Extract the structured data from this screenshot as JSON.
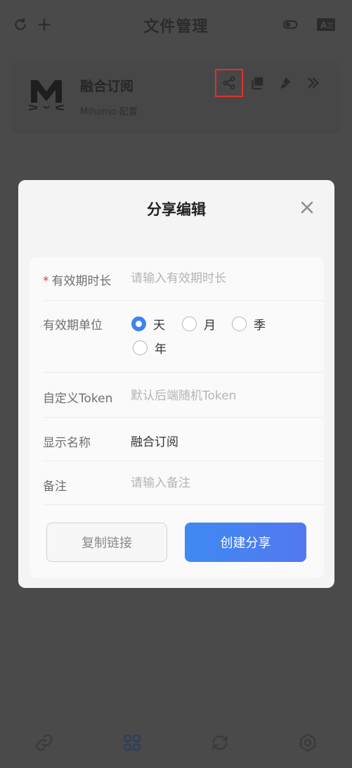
{
  "header": {
    "title": "文件管理",
    "left_icons": [
      "refresh-icon",
      "plus-icon"
    ],
    "right_icons": [
      "toggle-icon",
      "translate-icon"
    ]
  },
  "profile": {
    "name": "融合订阅",
    "subtitle": "Mihomo 配置",
    "actions": [
      "share-icon",
      "copy-icon",
      "edit-pen-icon",
      "more-chevron-icon"
    ]
  },
  "modal": {
    "title": "分享编辑",
    "fields": {
      "duration": {
        "label": "有效期时长",
        "required_mark": "*",
        "value": "",
        "placeholder": "请输入有效期时长"
      },
      "unit": {
        "label": "有效期单位",
        "options": [
          "天",
          "月",
          "季",
          "年"
        ],
        "selected": "天"
      },
      "token": {
        "label": "自定义Token",
        "value": "",
        "placeholder": "默认后端随机Token"
      },
      "display_name": {
        "label": "显示名称",
        "value": "融合订阅"
      },
      "remark": {
        "label": "备注",
        "value": "",
        "placeholder": "请输入备注"
      }
    },
    "buttons": {
      "copy_link": "复制链接",
      "create_share": "创建分享"
    }
  },
  "bottom_nav": {
    "items": [
      "link-icon",
      "grid-icon",
      "sync-icon",
      "settings-icon"
    ],
    "active": "grid-icon"
  },
  "colors": {
    "accent": "#3d82f0",
    "required": "#e4393c",
    "highlight_box": "#e0312f",
    "overlay": "#4a4a4a"
  }
}
